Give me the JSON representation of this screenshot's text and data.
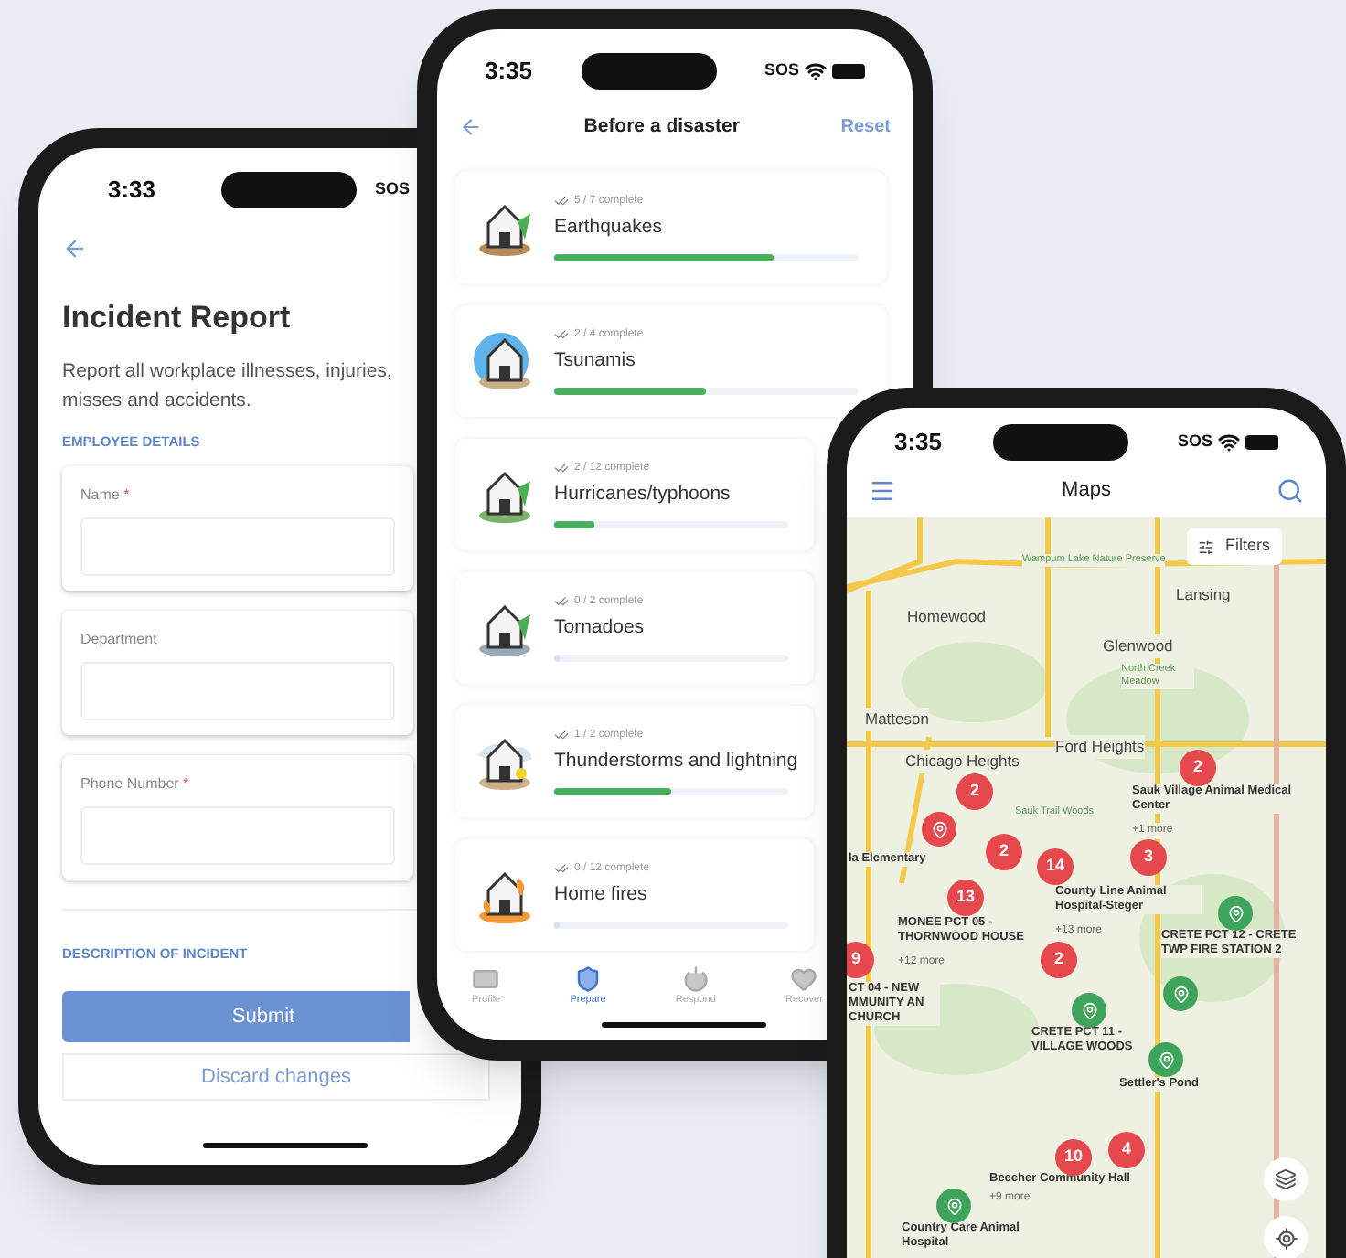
{
  "incident_phone": {
    "status": {
      "time": "3:33",
      "carrier": "SOS"
    },
    "title": "Incident Report",
    "description_lines": [
      "Report all workplace illnesses, injuries,",
      "misses and accidents."
    ],
    "section": "EMPLOYEE DETAILS",
    "fields": [
      {
        "label": "Name",
        "required_mark": "*"
      },
      {
        "label": "Department"
      },
      {
        "label": "Phone Number",
        "required_mark": "*"
      }
    ],
    "section_2": "DESCRIPTION OF INCIDENT",
    "submit": "Submit",
    "discard": "Discard changes"
  },
  "checklist_phone": {
    "status": {
      "time": "3:35",
      "carrier": "SOS"
    },
    "title": "Before a disaster",
    "reset": "Reset",
    "items": [
      {
        "kind": "earthquake",
        "progress": "5 / 7 complete",
        "name": "Earthquakes",
        "level": 0.72
      },
      {
        "kind": "tsunami",
        "progress": "2 / 4 complete",
        "name": "Tsunamis",
        "level": 0.5
      },
      {
        "kind": "hurricane",
        "progress": "2 / 12 complete",
        "name": "Hurricanes/typhoons",
        "level": 0.17
      },
      {
        "kind": "tornado",
        "progress": "0 / 2 complete",
        "name": "Tornadoes",
        "level": 0
      },
      {
        "kind": "storm",
        "progress": "1 / 2 complete",
        "name": "Thunderstorms and lightning",
        "level": 0.5
      },
      {
        "kind": "fire",
        "progress": "0 / 12 complete",
        "name": "Home fires",
        "level": 0
      }
    ],
    "tabs": [
      {
        "kind": "profile",
        "label": "Profile",
        "selected": false
      },
      {
        "kind": "prepare",
        "label": "Prepare",
        "selected": true
      },
      {
        "kind": "respond",
        "label": "Respond",
        "selected": false
      },
      {
        "kind": "recover",
        "label": "Recover",
        "selected": false
      }
    ]
  },
  "maps_phone": {
    "status": {
      "time": "3:35",
      "carrier": "SOS"
    },
    "title": "Maps",
    "filters": "Filters",
    "labels": [
      {
        "kind": "park",
        "text": "Wampum Lake Nature Preserve"
      },
      {
        "kind": "town",
        "text": "Lansing"
      },
      {
        "kind": "town",
        "text": "Homewood"
      },
      {
        "kind": "town",
        "text": "Glenwood"
      },
      {
        "kind": "park",
        "text": "North Creek Meadow"
      },
      {
        "kind": "town",
        "text": "Matteson"
      },
      {
        "kind": "town",
        "text": "Ford Heights"
      },
      {
        "kind": "town",
        "text": "Chicago Heights"
      },
      {
        "kind": "site",
        "text": "Sauk Village Animal Medical Center"
      },
      {
        "kind": "park",
        "text": "Sauk Trail Woods"
      },
      {
        "kind": "more",
        "text": "+1 more"
      },
      {
        "kind": "site",
        "text": "la Elementary"
      },
      {
        "kind": "site",
        "text": "County Line Animal Hospital-Steger"
      },
      {
        "kind": "more",
        "text": "+13 more"
      },
      {
        "kind": "site",
        "text": "MONEE PCT 05 - THORNWOOD HOUSE"
      },
      {
        "kind": "site",
        "text": "CRETE PCT 12 - CRETE TWP FIRE STATION 2"
      },
      {
        "kind": "more",
        "text": "+12 more"
      },
      {
        "kind": "site",
        "text": "CT 04 - NEW MMUNITY AN CHURCH"
      },
      {
        "kind": "site",
        "text": "CRETE PCT 11 - VILLAGE WOODS"
      },
      {
        "kind": "site",
        "text": "Settler's Pond"
      },
      {
        "kind": "site",
        "text": "Beecher Community Hall"
      },
      {
        "kind": "more",
        "text": "+9 more"
      },
      {
        "kind": "site",
        "text": "Country Care Animal Hospital"
      }
    ],
    "pins": [
      {
        "kind": "cluster",
        "text": "2",
        "color": "#e5484d"
      },
      {
        "kind": "marker",
        "color": "#e5484d"
      },
      {
        "kind": "cluster",
        "text": "2",
        "color": "#e5484d"
      },
      {
        "kind": "cluster",
        "text": "14",
        "color": "#e5484d"
      },
      {
        "kind": "cluster",
        "text": "3",
        "color": "#e5484d"
      },
      {
        "kind": "cluster",
        "text": "2",
        "color": "#e5484d"
      },
      {
        "kind": "cluster",
        "text": "13",
        "color": "#e5484d"
      },
      {
        "kind": "cluster",
        "text": "2",
        "color": "#e5484d"
      },
      {
        "kind": "cluster",
        "text": "9",
        "color": "#e5484d"
      },
      {
        "kind": "cluster",
        "text": "10",
        "color": "#e5484d"
      },
      {
        "kind": "cluster",
        "text": "4",
        "color": "#e5484d"
      },
      {
        "kind": "marker",
        "color": "#3fa45b"
      },
      {
        "kind": "marker",
        "color": "#3fa45b"
      },
      {
        "kind": "marker",
        "color": "#3fa45b"
      },
      {
        "kind": "marker",
        "color": "#3fa45b"
      },
      {
        "kind": "marker",
        "color": "#3fa45b"
      }
    ]
  }
}
